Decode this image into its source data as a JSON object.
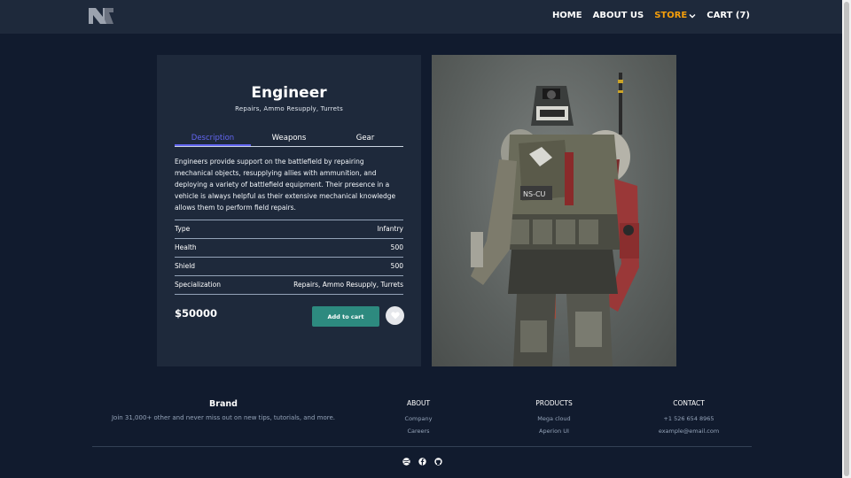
{
  "nav": {
    "items": [
      "HOME",
      "ABOUT US"
    ],
    "store": "STORE",
    "cart": "CART (7)"
  },
  "product": {
    "name": "Engineer",
    "subtitle": "Repairs, Ammo Resupply, Turrets",
    "tabs": [
      "Description",
      "Weapons",
      "Gear"
    ],
    "description": "Engineers provide support on the battlefield by repairing mechanical objects, resupplying allies with ammunition, and deploying a variety of battlefield equipment. Their presence in a vehicle is always helpful as their extensive mechanical knowledge allows them to perform field repairs.",
    "specs": [
      {
        "label": "Type",
        "value": "Infantry"
      },
      {
        "label": "Health",
        "value": "500"
      },
      {
        "label": "Shield",
        "value": "500"
      },
      {
        "label": "Specialization",
        "value": "Repairs, Ammo Resupply, Turrets"
      }
    ],
    "price": "$50000",
    "add_to_cart": "Add to cart",
    "badge": "NS-CU"
  },
  "footer": {
    "brand_title": "Brand",
    "brand_text": "Join 31,000+ other and never miss out on new tips, tutorials, and more.",
    "about": {
      "title": "ABOUT",
      "links": [
        "Company",
        "Careers"
      ]
    },
    "products": {
      "title": "PRODUCTS",
      "links": [
        "Mega cloud",
        "Aperion UI"
      ]
    },
    "contact": {
      "title": "CONTACT",
      "links": [
        "+1 526 654 8965",
        "example@email.com"
      ]
    }
  },
  "colors": {
    "accent": "#f59e0b",
    "tab_active": "#6366f1",
    "cta": "#2d8a7f"
  },
  "icons": [
    "logo-icon",
    "chevron-down-icon",
    "heart-icon",
    "dribbble-icon",
    "facebook-icon",
    "github-icon"
  ]
}
